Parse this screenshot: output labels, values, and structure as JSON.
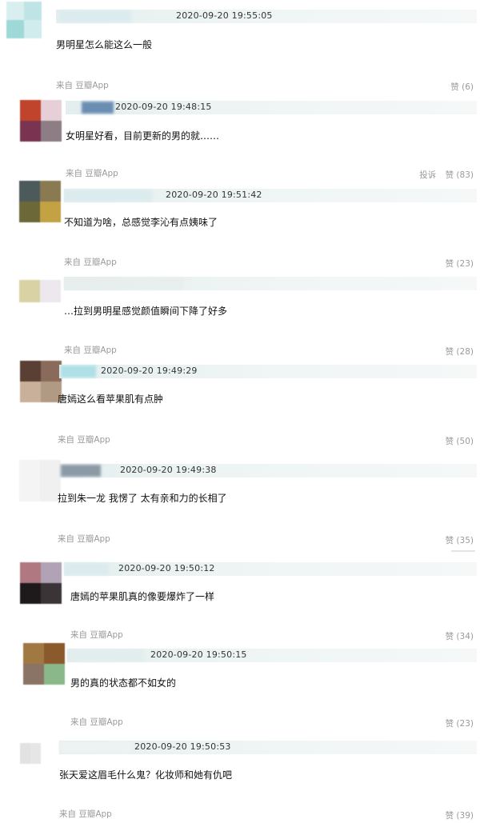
{
  "comments": [
    {
      "time": "2020-09-20 19:55:05",
      "text": "男明星怎么能这么一般",
      "source": "来自 豆瓣App",
      "like": "赞 (6)",
      "report": "",
      "avatar_colors": [
        "#d9eeee",
        "#bfe4e6",
        "#9fd9d7",
        "#d0ecec"
      ]
    },
    {
      "time": "2020-09-20 19:48:15",
      "text": "女明星好看，目前更新的男的就……",
      "source": "来自 豆瓣App",
      "like": "赞 (83)",
      "report": "投诉",
      "avatar_colors": [
        "#c0432c",
        "#e6cfd6",
        "#7a3350",
        "#8c7e84"
      ]
    },
    {
      "time": "2020-09-20 19:51:42",
      "text": "不知道为啥，总感觉李沁有点姨味了",
      "source": "来自 豆瓣App",
      "like": "赞 (23)",
      "report": "",
      "avatar_colors": [
        "#4c5a5c",
        "#8a7a52",
        "#6c6838",
        "#c2a242"
      ]
    },
    {
      "time": "",
      "text": "…拉到男明星感觉颜值瞬间下降了好多",
      "source": "来自 豆瓣App",
      "like": "赞 (28)",
      "report": "",
      "avatar_colors": [
        "#d9d2a4",
        "#ece8ee",
        "#d9d2a4",
        "#ece8ee"
      ]
    },
    {
      "time": "2020-09-20 19:49:29",
      "text": "唐嫣这么看苹果肌有点肿",
      "source": "来自 豆瓣App",
      "like": "赞 (50)",
      "report": "",
      "avatar_colors": [
        "#5a4034",
        "#8a6a5a",
        "#c8b09a",
        "#b09a84"
      ]
    },
    {
      "time": "2020-09-20 19:49:38",
      "text": "拉到朱一龙 我愣了 太有亲和力的长相了",
      "source": "来自 豆瓣App",
      "like": "赞 (35)",
      "report": "",
      "avatar_colors": [
        "#f4f4f4",
        "#f0f0f0",
        "#f4f4f4",
        "#f0f0f0"
      ]
    },
    {
      "time": "2020-09-20 19:50:12",
      "text": "唐嫣的苹果肌真的像要爆炸了一样",
      "source": "来自 豆瓣App",
      "like": "赞 (34)",
      "report": "",
      "avatar_colors": [
        "#b07880",
        "#b2a2b6",
        "#1e1a1c",
        "#3a3436"
      ]
    },
    {
      "time": "2020-09-20 19:50:15",
      "text": "男的真的状态都不如女的",
      "source": "来自 豆瓣App",
      "like": "赞 (23)",
      "report": "",
      "avatar_colors": [
        "#a07842",
        "#8a5a2c",
        "#8a7466",
        "#8ab88a"
      ]
    },
    {
      "time": "2020-09-20 19:50:53",
      "text": "张天爱这眉毛什么鬼？化妆师和她有仇吧",
      "source": "来自 豆瓣App",
      "like": "赞 (39)",
      "report": "",
      "avatar_colors": [
        "#e2e2e2",
        "#e6e6e6",
        "#e2e2e2",
        "#e6e6e6"
      ]
    }
  ]
}
